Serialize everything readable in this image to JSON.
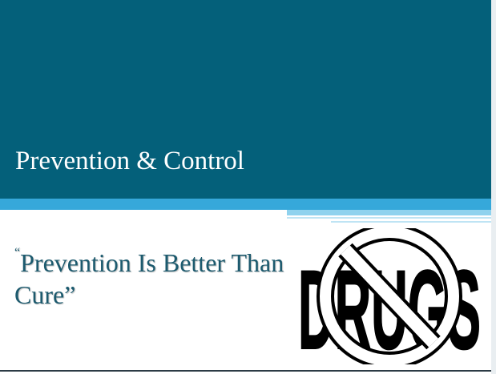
{
  "slide": {
    "title": "Prevention & Control",
    "quote": {
      "open_mark": "“",
      "text": "Prevention Is Better Than Cure",
      "close_mark": "”"
    },
    "logo_word": "DRUGS",
    "logo_icon": "no-drugs-icon"
  },
  "colors": {
    "title_band": "#04607a",
    "accent_stripe": "#36a8da",
    "quote_text": "#1c5a6e"
  }
}
